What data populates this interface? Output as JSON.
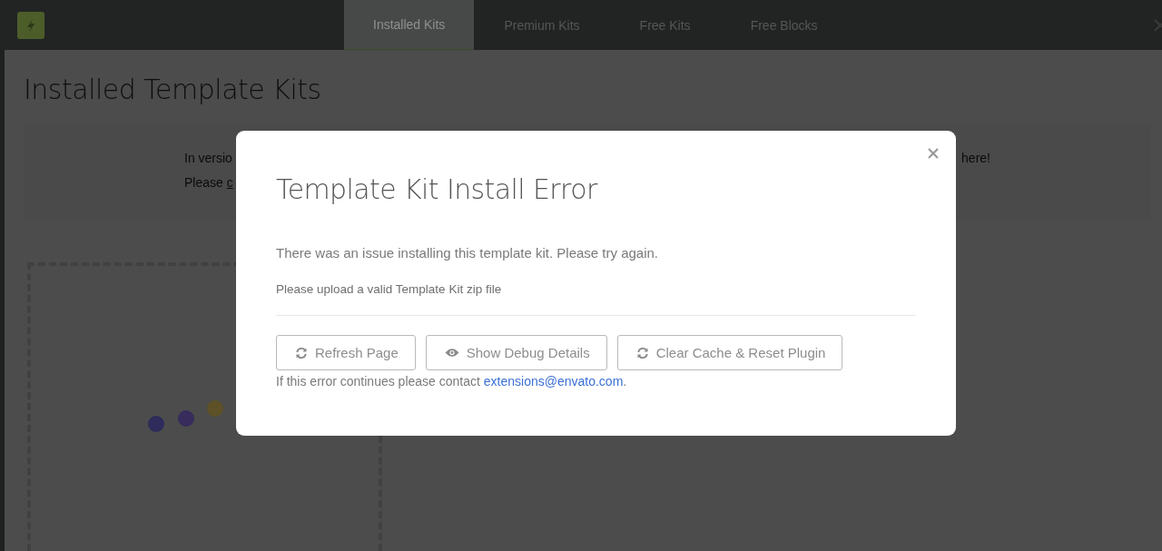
{
  "header": {
    "tabs": [
      {
        "label": "Installed Kits",
        "selected": true
      },
      {
        "label": "Premium Kits",
        "selected": false
      },
      {
        "label": "Free Kits",
        "selected": false
      },
      {
        "label": "Free Blocks",
        "selected": false
      }
    ]
  },
  "page": {
    "title": "Installed Template Kits",
    "notice": {
      "line_1_start": "In versio",
      "line_1_end": "here!",
      "line_2_start": "Please",
      "line_2_link": "c"
    }
  },
  "modal": {
    "title": "Template Kit Install Error",
    "message": "There was an issue installing this template kit. Please try again.",
    "detail": "Please upload a valid Template Kit zip file",
    "buttons": [
      {
        "label": "Refresh Page",
        "kind": "refresh"
      },
      {
        "label": "Show Debug Details",
        "kind": "eye"
      },
      {
        "label": "Clear Cache & Reset Plugin",
        "kind": "refresh"
      }
    ],
    "footer": {
      "text": "If this error continues please contact",
      "link": "extensions@envato.com",
      "after": "."
    }
  }
}
